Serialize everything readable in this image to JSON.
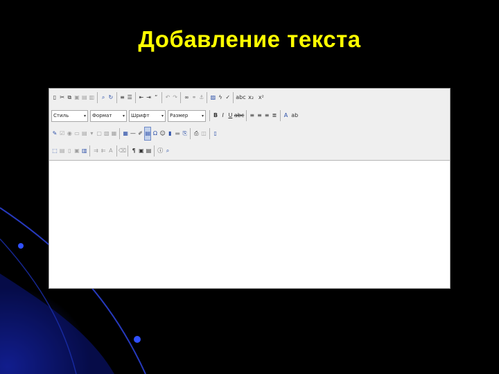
{
  "slide": {
    "title": "Добавление текста"
  },
  "colors": {
    "background": "#000000",
    "title": "#ffff00",
    "toolbar": "#efefef",
    "editor_area": "#ffffff",
    "decor_blue": "#1a2a9a"
  },
  "toolbar": {
    "row1": [
      {
        "icon": "source-icon",
        "glyph": "▯"
      },
      {
        "icon": "cut-icon",
        "glyph": "✂"
      },
      {
        "icon": "copy-icon",
        "glyph": "⧉"
      },
      {
        "icon": "paste-icon",
        "glyph": "▣"
      },
      {
        "icon": "paste-text-icon",
        "glyph": "▤"
      },
      {
        "icon": "paste-word-icon",
        "glyph": "▥"
      },
      {
        "icon": "find-icon",
        "glyph": "⌕"
      },
      {
        "icon": "replace-icon",
        "glyph": "↻"
      },
      {
        "icon": "numbered-list-icon",
        "glyph": "≡"
      },
      {
        "icon": "bulleted-list-icon",
        "glyph": "☰"
      },
      {
        "icon": "outdent-icon",
        "glyph": "⇤"
      },
      {
        "icon": "indent-icon",
        "glyph": "⇥"
      },
      {
        "icon": "blockquote-icon",
        "glyph": "“"
      },
      {
        "icon": "undo-icon",
        "glyph": "↶"
      },
      {
        "icon": "redo-icon",
        "glyph": "↷"
      },
      {
        "icon": "link-icon",
        "glyph": "∞"
      },
      {
        "icon": "unlink-icon",
        "glyph": "⚭"
      },
      {
        "icon": "anchor-icon",
        "glyph": "⚓"
      },
      {
        "icon": "image-icon",
        "glyph": "▨"
      },
      {
        "icon": "flash-icon",
        "glyph": "ϟ"
      },
      {
        "icon": "spellcheck-icon",
        "glyph": "✓"
      },
      {
        "icon": "abc-icon",
        "glyph": "abc"
      },
      {
        "icon": "subscript-icon",
        "glyph": "x₂"
      },
      {
        "icon": "superscript-icon",
        "glyph": "x²"
      }
    ],
    "combos": [
      {
        "label": "Стиль",
        "arrow": "▾"
      },
      {
        "label": "Формат",
        "arrow": "▾"
      },
      {
        "label": "Шрифт",
        "arrow": "▾"
      },
      {
        "label": "Размер",
        "arrow": "▾"
      }
    ],
    "row2": [
      {
        "icon": "bold-icon",
        "glyph": "B"
      },
      {
        "icon": "italic-icon",
        "glyph": "I"
      },
      {
        "icon": "underline-icon",
        "glyph": "U"
      },
      {
        "icon": "strikethrough-icon",
        "glyph": "abc"
      },
      {
        "icon": "align-left-icon",
        "glyph": "≡"
      },
      {
        "icon": "align-center-icon",
        "glyph": "≡"
      },
      {
        "icon": "align-right-icon",
        "glyph": "≡"
      },
      {
        "icon": "justify-icon",
        "glyph": "≣"
      },
      {
        "icon": "text-color-icon",
        "glyph": "A"
      },
      {
        "icon": "bg-color-icon",
        "glyph": "ab"
      }
    ],
    "row3": [
      {
        "icon": "form-icon",
        "glyph": "✎"
      },
      {
        "icon": "checkbox-icon",
        "glyph": "☑"
      },
      {
        "icon": "radio-icon",
        "glyph": "◉"
      },
      {
        "icon": "textfield-icon",
        "glyph": "▭"
      },
      {
        "icon": "textarea-icon",
        "glyph": "▤"
      },
      {
        "icon": "select-icon",
        "glyph": "▾"
      },
      {
        "icon": "button-icon",
        "glyph": "▢"
      },
      {
        "icon": "imagebutton-icon",
        "glyph": "▧"
      },
      {
        "icon": "hidden-field-icon",
        "glyph": "▦"
      },
      {
        "icon": "table-icon",
        "glyph": "▦"
      },
      {
        "icon": "horizontal-rule-icon",
        "glyph": "—"
      },
      {
        "icon": "edit-icon",
        "glyph": "✐"
      },
      {
        "icon": "page-icon",
        "glyph": "▤"
      },
      {
        "icon": "special-char-icon",
        "glyph": "Ω"
      },
      {
        "icon": "smiley-icon",
        "glyph": "☺"
      },
      {
        "icon": "media-icon",
        "glyph": "▮"
      },
      {
        "icon": "iframe-icon",
        "glyph": "▬"
      },
      {
        "icon": "page-break-icon",
        "glyph": "⎘"
      },
      {
        "icon": "print-icon",
        "glyph": "⎙"
      },
      {
        "icon": "preview-icon",
        "glyph": "◫"
      },
      {
        "icon": "maximize-icon",
        "glyph": "▯"
      }
    ],
    "row4": [
      {
        "icon": "select-all-icon",
        "glyph": "⬚"
      },
      {
        "icon": "templates-icon",
        "glyph": "▤"
      },
      {
        "icon": "new-page-icon",
        "glyph": "▯"
      },
      {
        "icon": "save-icon",
        "glyph": "▣"
      },
      {
        "icon": "div-icon",
        "glyph": "▥"
      },
      {
        "icon": "bidi-ltr-icon",
        "glyph": "⇉"
      },
      {
        "icon": "bidi-rtl-icon",
        "glyph": "⇇"
      },
      {
        "icon": "language-icon",
        "glyph": "A"
      },
      {
        "icon": "remove-format-icon",
        "glyph": "⌫"
      },
      {
        "icon": "show-blocks-icon",
        "glyph": "¶"
      },
      {
        "icon": "show-borders-icon",
        "glyph": "▣"
      },
      {
        "icon": "create-div-icon",
        "glyph": "▤"
      },
      {
        "icon": "about-icon",
        "glyph": "ⓘ"
      },
      {
        "icon": "zoom-icon",
        "glyph": "⌕"
      }
    ]
  }
}
